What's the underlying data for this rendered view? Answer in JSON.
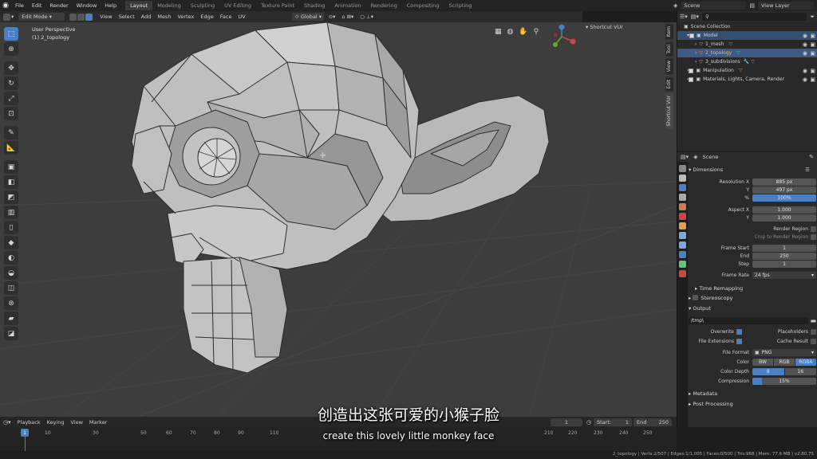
{
  "menubar": {
    "items": [
      "File",
      "Edit",
      "Render",
      "Window",
      "Help"
    ],
    "workspaces": [
      "Layout",
      "Modeling",
      "Sculpting",
      "UV Editing",
      "Texture Paint",
      "Shading",
      "Animation",
      "Rendering",
      "Compositing",
      "Scripting"
    ],
    "active_workspace": "Layout",
    "scene": "Scene",
    "view_layer": "View Layer"
  },
  "viewport_header": {
    "mode": "Edit Mode",
    "menus": [
      "View",
      "Select",
      "Add",
      "Mesh",
      "Vertex",
      "Edge",
      "Face",
      "UV"
    ],
    "orientation": "Global"
  },
  "viewport": {
    "view_name": "User Perspective",
    "object_label": "(1) 2_topology"
  },
  "nsidebar": {
    "tabs": [
      "Item",
      "Tool",
      "View",
      "Edit",
      "Shortcut VUr"
    ],
    "panel_title": "Shortcut VUr"
  },
  "outliner": {
    "root": "Scene Collection",
    "rows": [
      {
        "label": "Model",
        "indent": 1
      },
      {
        "label": "1_mesh",
        "indent": 2
      },
      {
        "label": "2_topology",
        "indent": 2
      },
      {
        "label": "3_subdivisions",
        "indent": 2
      },
      {
        "label": "Manipulation",
        "indent": 1
      },
      {
        "label": "Materials, Lights, Camera, Render",
        "indent": 1
      }
    ]
  },
  "properties": {
    "context": "Scene",
    "dimensions_label": "Dimensions",
    "resolution_x_label": "Resolution X",
    "resolution_x": "885 px",
    "y_label": "Y",
    "resolution_y": "497 px",
    "percent_label": "%",
    "percent": "100%",
    "aspect_x_label": "Aspect X",
    "aspect_x": "1.000",
    "aspect_y": "1.000",
    "render_region": "Render Region",
    "crop_region": "Crop to Render Region",
    "frame_start_label": "Frame Start",
    "frame_start": "1",
    "end_label": "End",
    "frame_end": "250",
    "step_label": "Step",
    "frame_step": "1",
    "frame_rate_label": "Frame Rate",
    "frame_rate": "24 fps",
    "time_remapping": "Time Remapping",
    "stereoscopy": "Stereoscopy",
    "output": "Output",
    "output_path": "/tmp\\",
    "overwrite": "Overwrite",
    "placeholders": "Placeholders",
    "file_extensions": "File Extensions",
    "cache_result": "Cache Result",
    "file_format_label": "File Format",
    "file_format": "PNG",
    "color_label": "Color",
    "color_options": [
      "BW",
      "RGB",
      "RGBA"
    ],
    "color_depth_label": "Color Depth",
    "color_depth_options": [
      "8",
      "16"
    ],
    "compression_label": "Compression",
    "compression": "15%",
    "metadata": "Metadata",
    "post_processing": "Post Processing"
  },
  "timeline": {
    "menus": [
      "Playback",
      "Keying",
      "View",
      "Marker"
    ],
    "current_frame": "1",
    "start_label": "Start:",
    "start": "1",
    "end_label": "End",
    "end": "250",
    "ticks": [
      "1",
      "10",
      "30",
      "50",
      "60",
      "70",
      "80",
      "90",
      "110",
      "210",
      "220",
      "230",
      "240",
      "250"
    ]
  },
  "statusbar": {
    "text": "2_topology | Verts:2/507 | Edges:1/1,005 | Faces:0/500 | Tris:968 | Mem: 77.6 MB | v2.80.75"
  },
  "subtitles": {
    "zh": "创造出这张可爱的小猴子脸",
    "en": "create this lovely little monkey face"
  },
  "colors": {
    "accent": "#4a7fc2",
    "mesh_face": "#bdbdbd",
    "viewport_bg": "#3d3d3d"
  }
}
